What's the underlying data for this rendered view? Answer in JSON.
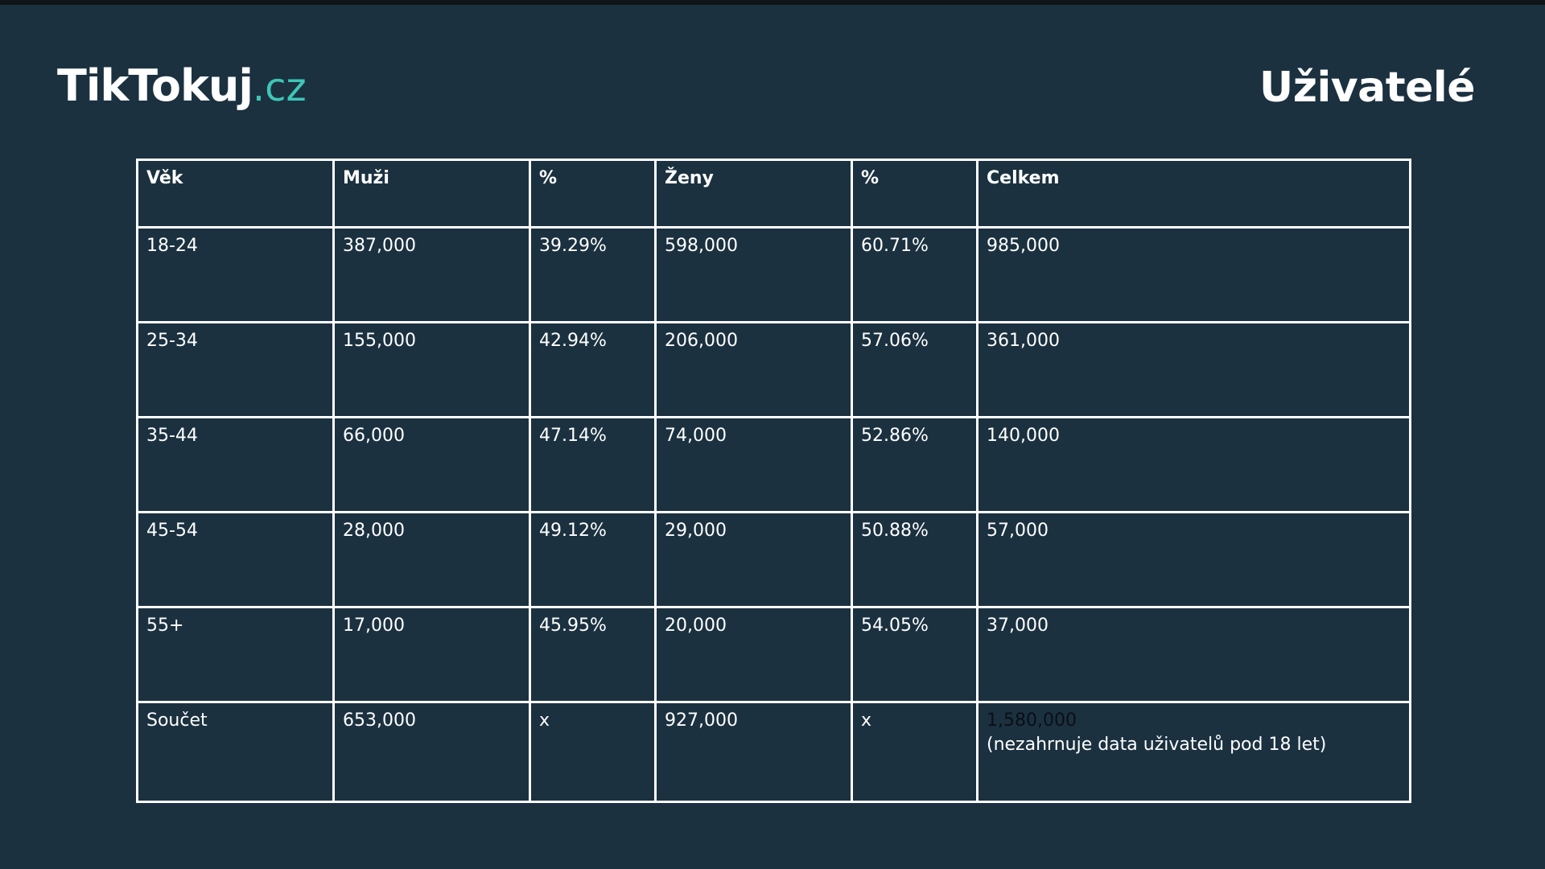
{
  "header": {
    "logo_brand": "TikTokuj",
    "logo_tld": ".cz",
    "title": "Uživatelé"
  },
  "colors": {
    "background": "#1b3140",
    "accent": "#3ec6b6",
    "text": "#ffffff",
    "grid": "#ffffff"
  },
  "chart_data": {
    "type": "table",
    "columns": [
      "Věk",
      "Muži",
      "%",
      "Ženy",
      "%",
      "Celkem"
    ],
    "rows": [
      [
        "18-24",
        "387,000",
        "39.29%",
        "598,000",
        "60.71%",
        "985,000"
      ],
      [
        "25-34",
        "155,000",
        "42.94%",
        "206,000",
        "57.06%",
        "361,000"
      ],
      [
        "35-44",
        "66,000",
        "47.14%",
        "74,000",
        "52.86%",
        "140,000"
      ],
      [
        "45-54",
        "28,000",
        "49.12%",
        "29,000",
        "50.88%",
        "57,000"
      ],
      [
        "55+",
        "17,000",
        "45.95%",
        "20,000",
        "54.05%",
        "37,000"
      ]
    ],
    "summary": {
      "label": "Součet",
      "men": "653,000",
      "men_pct": "x",
      "women": "927,000",
      "women_pct": "x",
      "total": "1,580,000",
      "total_note": "(nezahrnuje data uživatelů pod 18 let)"
    }
  }
}
